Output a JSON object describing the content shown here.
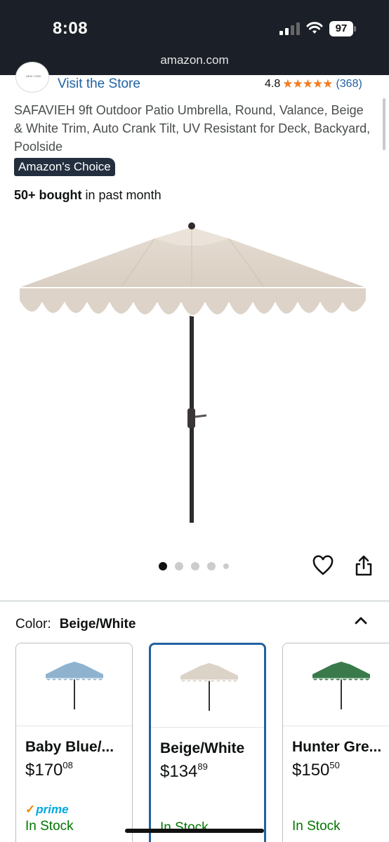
{
  "status_bar": {
    "time": "8:08",
    "battery": "97",
    "url": "amazon.com"
  },
  "store": {
    "logo_text": "NEW YORK",
    "visit_label": "Visit the Store",
    "rating": "4.8",
    "stars": "★★★★★",
    "rating_count": "(368)"
  },
  "product": {
    "title": "SAFAVIEH 9ft Outdoor Patio Umbrella, Round, Valance, Beige & White Trim, Auto Crank Tilt, UV Resistant for Deck, Backyard, Poolside",
    "badge": "Amazon's Choice",
    "bought_bold": "50+ bought",
    "bought_rest": " in past month"
  },
  "gallery": {
    "image_count": 5,
    "active_index": 0
  },
  "colors": {
    "accent": "#2162a1",
    "star": "#f57b20",
    "stock": "#007600",
    "header_bg": "#1b1f27"
  },
  "variant": {
    "label": "Color:",
    "selected": "Beige/White",
    "options": [
      {
        "name": "Baby Blue/...",
        "price_dollars": "$170",
        "price_cents": "08",
        "prime_label": "prime",
        "stock": "In Stock",
        "canopy_color": "#8fb3cf",
        "selected": false
      },
      {
        "name": "Beige/White",
        "price_dollars": "$134",
        "price_cents": "89",
        "prime_label": "",
        "stock": "In Stock",
        "canopy_color": "#dcd3c8",
        "selected": true
      },
      {
        "name": "Hunter Gre...",
        "price_dollars": "$150",
        "price_cents": "50",
        "prime_label": "",
        "stock": "In Stock",
        "canopy_color": "#3a7a4a",
        "selected": false
      }
    ]
  }
}
